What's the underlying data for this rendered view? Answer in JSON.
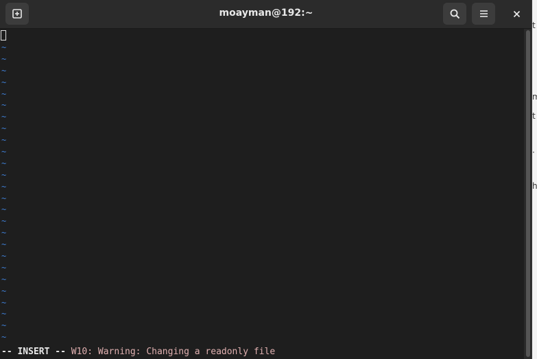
{
  "window": {
    "title": "moayman@192:~"
  },
  "titlebar": {
    "new_tab_icon": "new-tab-icon",
    "search_icon": "search-icon",
    "menu_icon": "hamburger-menu-icon",
    "close_icon": "close-icon"
  },
  "terminal": {
    "empty_line_marker": "~",
    "empty_line_count": 26,
    "status": {
      "mode": "-- INSERT --",
      "message": " W10: Warning: Changing a readonly file"
    }
  },
  "colors": {
    "terminal_bg": "#1e1e1e",
    "titlebar_bg": "#2b2b2b",
    "tilde": "#3f7fd6",
    "warning_text": "#e0b0b0"
  },
  "background_window": {
    "fragments": [
      "t",
      "m",
      "t",
      "·",
      "h"
    ]
  }
}
